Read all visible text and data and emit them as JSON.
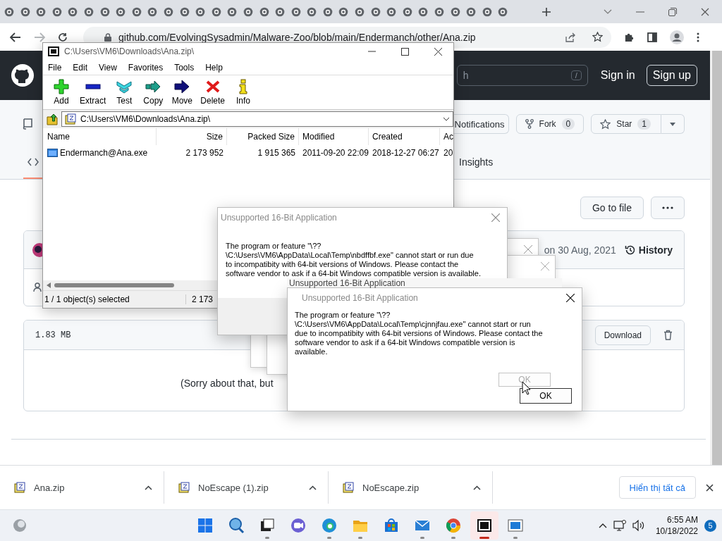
{
  "browser": {
    "url": "github.com/EvolvingSysadmin/Malware-Zoo/blob/main/Endermanch/other/Ana.zip"
  },
  "github": {
    "search_placeholder": "h",
    "search_key": "/",
    "sign_in": "Sign in",
    "sign_up": "Sign up",
    "repo_buttons": [
      {
        "kind": "notifications",
        "label": "Notifications"
      },
      {
        "kind": "fork",
        "label": "Fork",
        "count": "0"
      },
      {
        "kind": "star",
        "label": "Star",
        "count": "1"
      }
    ],
    "tabs": [
      {
        "kind": "code",
        "selected": true
      },
      {
        "kind": "text",
        "label": "Insights",
        "selected": false
      }
    ],
    "go_to_file": "Go to file",
    "commit": {
      "date": "on 30 Aug, 2021",
      "history": "History"
    },
    "file": {
      "size": "1.83 MB",
      "download": "Download",
      "message": "(Sorry about that, but"
    }
  },
  "archiver": {
    "title": "C:\\Users\\VM6\\Downloads\\Ana.zip\\",
    "menu": [
      "File",
      "Edit",
      "View",
      "Favorites",
      "Tools",
      "Help"
    ],
    "toolbar": [
      {
        "kind": "add",
        "label": "Add"
      },
      {
        "kind": "extract",
        "label": "Extract"
      },
      {
        "kind": "test",
        "label": "Test"
      },
      {
        "kind": "copy",
        "label": "Copy"
      },
      {
        "kind": "move",
        "label": "Move"
      },
      {
        "kind": "delete",
        "label": "Delete"
      },
      {
        "kind": "info",
        "label": "Info"
      }
    ],
    "path": "C:\\Users\\VM6\\Downloads\\Ana.zip\\",
    "columns": [
      "Name",
      "Size",
      "Packed Size",
      "Modified",
      "Created",
      "Ac"
    ],
    "rows": [
      [
        "Endermanch@Ana.exe",
        "2 173 952",
        "1 915 365",
        "2011-09-20 22:09",
        "2018-12-27 06:27",
        "20"
      ]
    ],
    "status": [
      "1 / 1 object(s) selected",
      "2 173"
    ]
  },
  "dialogs": [
    {
      "title": "Unsupported 16-Bit Application",
      "message": "The program or feature \"\\??\\C:\\Users\\VM6\\AppData\\Local\\Temp\\nbdffbf.exe\" cannot start or run due to incompatibity with 64-bit versions of Windows. Please contact the software vendor to ask if a 64-bit Windows compatible version is available."
    },
    {
      "title": "Unsupported 16-Bit Application",
      "message": "The program or feature \"\\??\\C:\\Users\\VM6\\AppData\\Local\\Temp\\cjnnjfau.exe\" cannot start or run due to incompatibity with 64-bit versions of Windows. Please contact the software vendor to ask if a 64-bit Windows compatible version is available.",
      "buttons": [
        {
          "label": "OK",
          "disabled": true
        },
        {
          "label": "OK",
          "disabled": false
        }
      ]
    }
  ],
  "ghost_title": "Unsupported 16-Bit Application",
  "downloads": {
    "items": [
      {
        "name": "Ana.zip"
      },
      {
        "name": "NoEscape (1).zip"
      },
      {
        "name": "NoEscape.zip"
      }
    ],
    "show_all": "Hiển thị tất cả"
  },
  "taskbar": {
    "apps": [
      {
        "kind": "start",
        "running": false,
        "active": false
      },
      {
        "kind": "search",
        "running": false,
        "active": false
      },
      {
        "kind": "taskview",
        "running": true,
        "active": false
      },
      {
        "kind": "chat",
        "running": false,
        "active": false
      },
      {
        "kind": "edge",
        "running": true,
        "active": false
      },
      {
        "kind": "explorer",
        "running": true,
        "active": false
      },
      {
        "kind": "store",
        "running": false,
        "active": false
      },
      {
        "kind": "mail",
        "running": true,
        "active": false
      },
      {
        "kind": "chrome",
        "running": true,
        "active": false
      },
      {
        "kind": "sevenzip",
        "running": true,
        "active": true
      },
      {
        "kind": "app",
        "running": true,
        "active": false
      }
    ],
    "time": "6:55 AM",
    "date": "10/18/2022",
    "notifications": "5"
  }
}
